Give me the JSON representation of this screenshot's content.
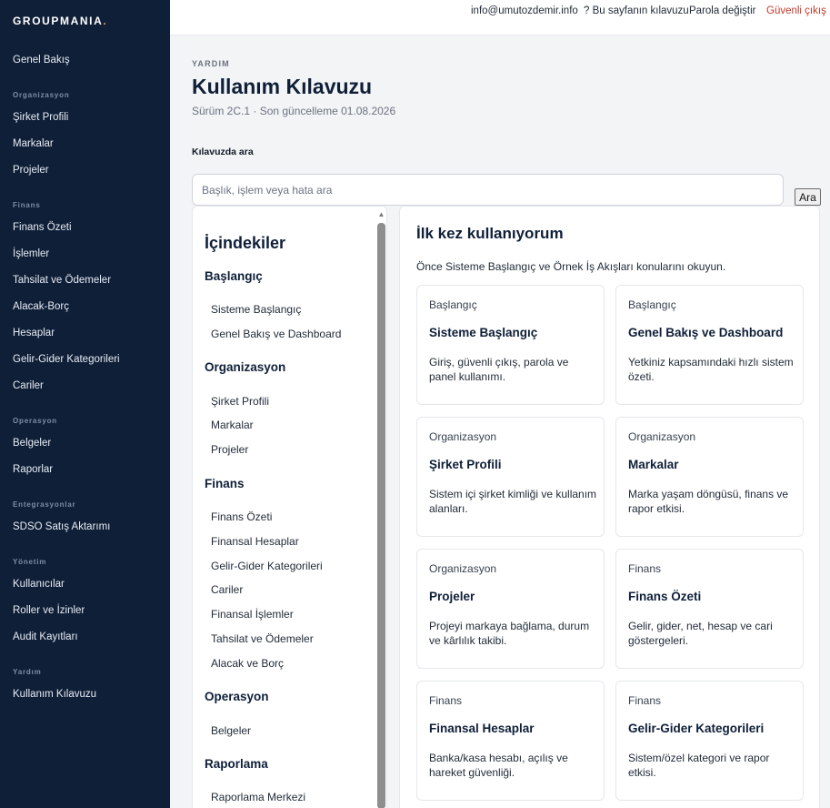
{
  "brand": {
    "name": "GROUPMANIA",
    "dot": "."
  },
  "sidebar": {
    "top": "Genel Bakış",
    "sections": [
      {
        "title": "Organizasyon",
        "items": [
          "Şirket Profili",
          "Markalar",
          "Projeler"
        ]
      },
      {
        "title": "Finans",
        "items": [
          "Finans Özeti",
          "İşlemler",
          "Tahsilat ve Ödemeler",
          "Alacak-Borç",
          "Hesaplar",
          "Gelir-Gider Kategorileri",
          "Cariler"
        ]
      },
      {
        "title": "Operasyon",
        "items": [
          "Belgeler",
          "Raporlar"
        ]
      },
      {
        "title": "Entegrasyonlar",
        "items": [
          "SDSO Satış Aktarımı"
        ]
      },
      {
        "title": "Yönetim",
        "items": [
          "Kullanıcılar",
          "Roller ve İzinler",
          "Audit Kayıtları"
        ]
      },
      {
        "title": "Yardım",
        "items": [
          "Kullanım Kılavuzu"
        ]
      }
    ]
  },
  "topbar": {
    "email": "info@umutozdemir.info",
    "guide": "? Bu sayfanın kılavuzu",
    "change_password": "Parola değiştir",
    "logout": "Güvenli çıkış"
  },
  "header": {
    "eyebrow": "YARDIM",
    "title": "Kullanım Kılavuzu",
    "subtitle": "Sürüm 2C.1 · Son güncelleme 01.08.2026"
  },
  "search": {
    "label": "Kılavuzda ara",
    "placeholder": "Başlık, işlem veya hata ara",
    "value": "",
    "button": "Ara"
  },
  "toc": {
    "title": "İçindekiler",
    "groups": [
      {
        "title": "Başlangıç",
        "items": [
          "Sisteme Başlangıç",
          "Genel Bakış ve Dashboard"
        ]
      },
      {
        "title": "Organizasyon",
        "items": [
          "Şirket Profili",
          "Markalar",
          "Projeler"
        ]
      },
      {
        "title": "Finans",
        "items": [
          "Finans Özeti",
          "Finansal Hesaplar",
          "Gelir-Gider Kategorileri",
          "Cariler",
          "Finansal İşlemler",
          "Tahsilat ve Ödemeler",
          "Alacak ve Borç"
        ]
      },
      {
        "title": "Operasyon",
        "items": [
          "Belgeler"
        ]
      },
      {
        "title": "Raporlama",
        "items": [
          "Raporlama Merkezi"
        ]
      }
    ]
  },
  "content": {
    "title": "İlk kez kullanıyorum",
    "intro": "Önce Sisteme Başlangıç ve Örnek İş Akışları konularını okuyun.",
    "cards": [
      {
        "category": "Başlangıç",
        "title": "Sisteme Başlangıç",
        "desc": "Giriş, güvenli çıkış, parola ve panel kullanımı."
      },
      {
        "category": "Başlangıç",
        "title": "Genel Bakış ve Dashboard",
        "desc": "Yetkiniz kapsamındaki hızlı sistem özeti."
      },
      {
        "category": "Organizasyon",
        "title": "Şirket Profili",
        "desc": "Sistem içi şirket kimliği ve kullanım alanları."
      },
      {
        "category": "Organizasyon",
        "title": "Markalar",
        "desc": "Marka yaşam döngüsü, finans ve rapor etkisi."
      },
      {
        "category": "Organizasyon",
        "title": "Projeler",
        "desc": "Projeyi markaya bağlama, durum ve kârlılık takibi."
      },
      {
        "category": "Finans",
        "title": "Finans Özeti",
        "desc": "Gelir, gider, net, hesap ve cari göstergeleri."
      },
      {
        "category": "Finans",
        "title": "Finansal Hesaplar",
        "desc": "Banka/kasa hesabı, açılış ve hareket güvenliği."
      },
      {
        "category": "Finans",
        "title": "Gelir-Gider Kategorileri",
        "desc": "Sistem/özel kategori ve rapor etkisi."
      }
    ]
  },
  "colors": {
    "sidebar_bg": "#0f1f38",
    "accent_gold": "#d4a84b",
    "danger": "#c0392b"
  }
}
